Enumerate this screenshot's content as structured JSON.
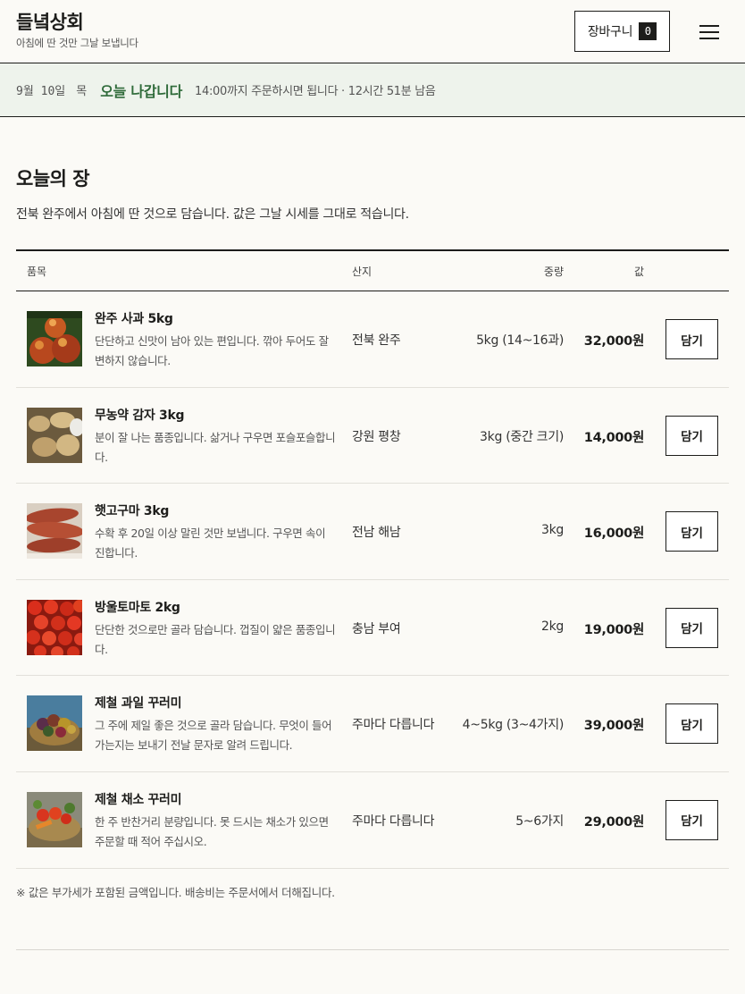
{
  "header": {
    "brand": "들녘상회",
    "tagline": "아침에 딴 것만 그날 보냅니다",
    "cart_label": "장바구니",
    "cart_count": "0",
    "menu_icon": "hamburger-menu-icon"
  },
  "notice": {
    "date": "9월 10일",
    "day": "목",
    "ship": "오늘 나갑니다",
    "deadline": "14:00까지 주문하시면 됩니다 · 12시간 51분 남음"
  },
  "section": {
    "title": "오늘의 장",
    "desc": "전북 완주에서 아침에 딴 것으로 담습니다. 값은 그날 시세를 그대로 적습니다."
  },
  "table": {
    "headers": {
      "item": "품목",
      "origin": "산지",
      "weight": "중량",
      "price": "값"
    },
    "rows": [
      {
        "name": "완주 사과 5kg",
        "desc": "단단하고 신맛이 남아 있는 편입니다. 깎아 두어도 잘 변하지 않습니다.",
        "origin": "전북 완주",
        "weight": "5kg (14~16과)",
        "price": "32,000원",
        "button": "담기",
        "image": "apples-photo"
      },
      {
        "name": "무농약 감자 3kg",
        "desc": "분이 잘 나는 품종입니다. 삶거나 구우면 포슬포슬합니다.",
        "origin": "강원 평창",
        "weight": "3kg (중간 크기)",
        "price": "14,000원",
        "button": "담기",
        "image": "potatoes-photo"
      },
      {
        "name": "햇고구마 3kg",
        "desc": "수확 후 20일 이상 말린 것만 보냅니다. 구우면 속이 진합니다.",
        "origin": "전남 해남",
        "weight": "3kg",
        "price": "16,000원",
        "button": "담기",
        "image": "sweet-potatoes-photo"
      },
      {
        "name": "방울토마토 2kg",
        "desc": "단단한 것으로만 골라 담습니다. 껍질이 얇은 품종입니다.",
        "origin": "충남 부여",
        "weight": "2kg",
        "price": "19,000원",
        "button": "담기",
        "image": "cherry-tomatoes-photo"
      },
      {
        "name": "제철 과일 꾸러미",
        "desc": "그 주에 제일 좋은 것으로 골라 담습니다. 무엇이 들어가는지는 보내기 전날 문자로 알려 드립니다.",
        "origin": "주마다 다릅니다",
        "weight": "4~5kg (3~4가지)",
        "price": "39,000원",
        "button": "담기",
        "image": "fruit-basket-photo"
      },
      {
        "name": "제철 채소 꾸러미",
        "desc": "한 주 반찬거리 분량입니다. 못 드시는 채소가 있으면 주문할 때 적어 주십시오.",
        "origin": "주마다 다릅니다",
        "weight": "5~6가지",
        "price": "29,000원",
        "button": "담기",
        "image": "vegetable-basket-photo"
      }
    ]
  },
  "footnote": "※ 값은 부가세가 포함된 금액입니다. 배송비는 주문서에서 더해집니다."
}
